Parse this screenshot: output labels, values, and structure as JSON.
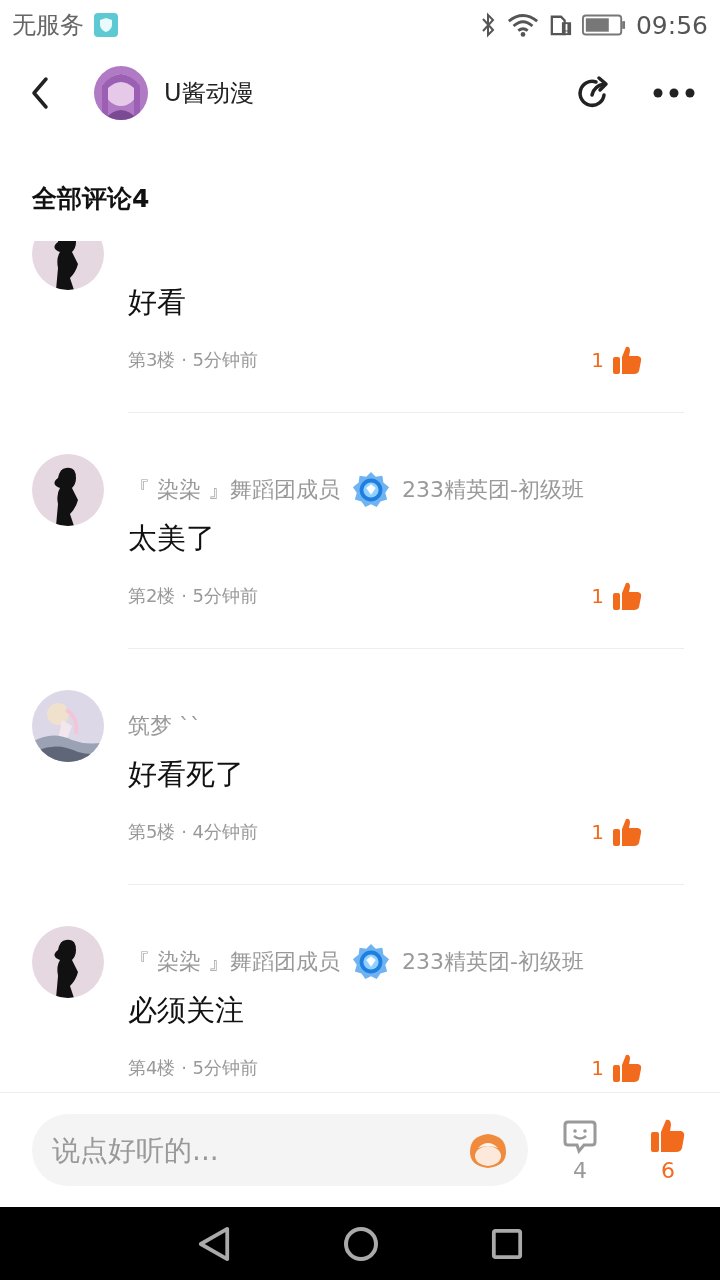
{
  "status_bar": {
    "carrier": "无服务",
    "time": "09:56"
  },
  "header": {
    "title": "U酱动漫"
  },
  "section_title": "全部评论4",
  "comments": [
    {
      "kind": "silhouette",
      "text": "好看",
      "meta": "第3楼 · 5分钟前",
      "likes": "1"
    },
    {
      "kind": "silhouette",
      "author": {
        "name": "『 染染 』舞蹈团成员",
        "badge": "233精英团-初级班"
      },
      "text": "太美了",
      "meta": "第2楼 · 5分钟前",
      "likes": "1"
    },
    {
      "kind": "picture",
      "author": {
        "name": "筑梦 ``"
      },
      "text": "好看死了",
      "meta": "第5楼 · 4分钟前",
      "likes": "1"
    },
    {
      "kind": "silhouette",
      "author": {
        "name": "『 染染 』舞蹈团成员",
        "badge": "233精英团-初级班"
      },
      "text": "必须关注",
      "meta": "第4楼 · 5分钟前",
      "likes": "1"
    }
  ],
  "composer": {
    "placeholder": "说点好听的...",
    "comment_count": "4",
    "like_count": "6"
  }
}
